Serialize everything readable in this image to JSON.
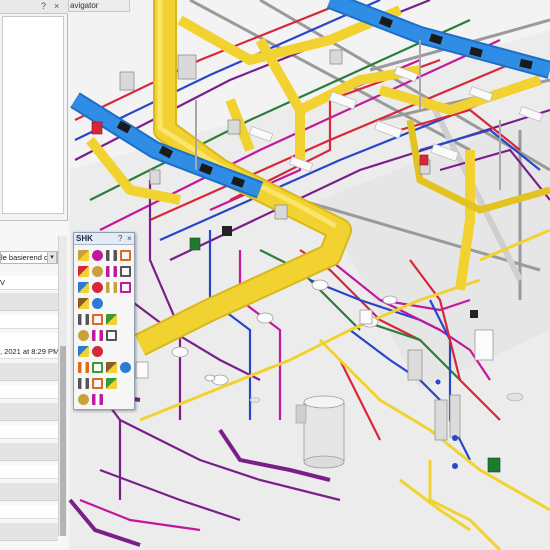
{
  "left_panel": {
    "help_btn": "?",
    "close_btn": "×",
    "combo_text": "le basierend der F",
    "combo_arrow": "▾",
    "row_text_1": "V",
    "row_date": ", 2021 at 8:29 PM"
  },
  "navigator_tab": {
    "label": "avigator"
  },
  "shk_palette": {
    "title": "SHK",
    "help_btn": "?",
    "close_btn": "×",
    "tool_icons": [
      "pipe-tool-icon",
      "riser-tool-icon",
      "valve-tool-icon",
      "fitting-tool-icon",
      "sink-tool-icon",
      "wc-tool-icon",
      "shower-tool-icon",
      "radiator-tool-icon",
      "pump-tool-icon",
      "tank-tool-icon",
      "boiler-tool-icon",
      "meter-tool-icon",
      "fire-tool-icon",
      "fire-hose-tool-icon",
      "arrow-tool-icon",
      "sprinkler-tool-icon",
      "cross-tool-icon",
      "triangle-tool-icon",
      "play-tool-icon",
      "plus-tool-icon",
      "manifold-tool-icon",
      "heater-tool-icon",
      "diamond-tool-icon",
      "valve-pair-tool-icon",
      "mixer-tool-icon",
      "gauge-tool-icon",
      "filter-tool-icon",
      "switch-tool-icon",
      "line-tool-icon",
      "cylinder-tool-icon",
      "box-tool-icon"
    ]
  },
  "colors": {
    "duct_yellow": "#f2d230",
    "duct_blue": "#2f8de6",
    "pipe_purple": "#7a1f8a",
    "pipe_red": "#d8263a",
    "pipe_blue": "#2746c8",
    "pipe_green": "#2d7d3a",
    "pipe_magenta": "#c2189c",
    "floor": "#f2f2f2"
  }
}
